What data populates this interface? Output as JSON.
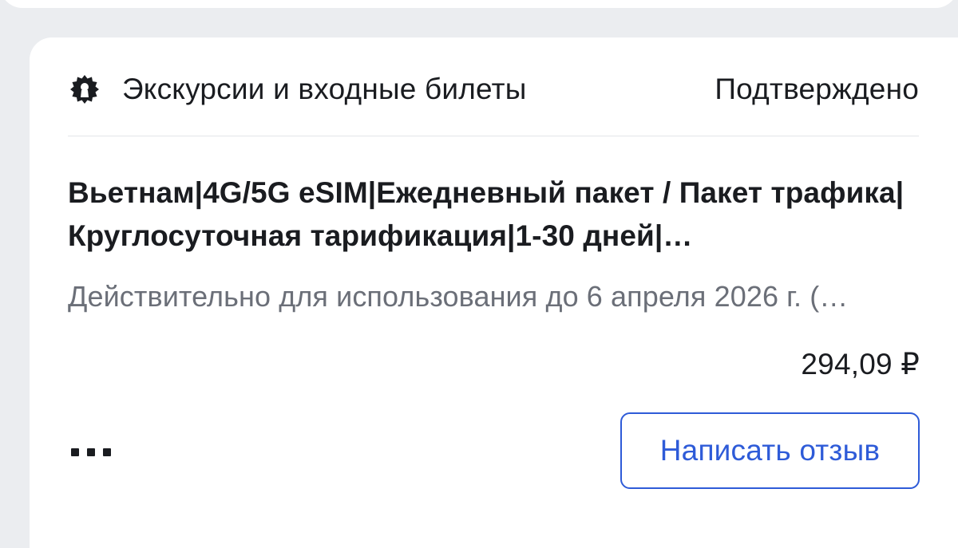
{
  "colors": {
    "page_background": "#ebedf0",
    "card_background": "#ffffff",
    "primary_text": "#1a1c20",
    "secondary_text": "#6b6f78",
    "accent": "#2e5bd8",
    "divider": "#e3e5e9"
  },
  "order": {
    "category_icon": "attraction-ticket-icon",
    "category": "Экскурсии и входные билеты",
    "status": "Подтверждено",
    "title": "Вьетнам|4G/5G eSIM|Ежедневный пакет / Пакет трафика|Круглосуточная тарификация|1-30 дней|…",
    "validity": "Действительно для использования до 6 апреля 2026 г. (…",
    "price": "294,09 ₽",
    "more_icon": "more-horizontal-icon",
    "review_button_label": "Написать отзыв"
  }
}
